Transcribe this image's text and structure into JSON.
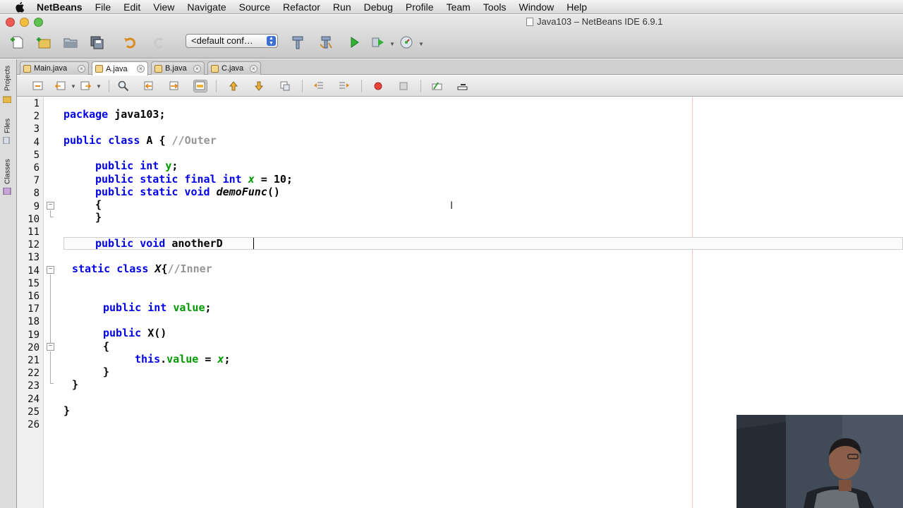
{
  "menubar": {
    "app_name": "NetBeans",
    "items": [
      "File",
      "Edit",
      "View",
      "Navigate",
      "Source",
      "Refactor",
      "Run",
      "Debug",
      "Profile",
      "Team",
      "Tools",
      "Window",
      "Help"
    ]
  },
  "window": {
    "title": "Java103 – NetBeans IDE 6.9.1"
  },
  "toolbar": {
    "config_value": "<default conf…"
  },
  "side_tabs": [
    "Projects",
    "Files",
    "Classes"
  ],
  "editor_tabs": [
    {
      "label": "Main.java",
      "active": false
    },
    {
      "label": "A.java",
      "active": true
    },
    {
      "label": "B.java",
      "active": false
    },
    {
      "label": "C.java",
      "active": false
    }
  ],
  "code_lines": [
    "1",
    "2",
    "3",
    "4",
    "5",
    "6",
    "7",
    "8",
    "9",
    "10",
    "11",
    "12",
    "13",
    "14",
    "15",
    "16",
    "17",
    "18",
    "19",
    "20",
    "21",
    "22",
    "23",
    "24",
    "25",
    "26"
  ],
  "code": {
    "l2_kw": "package",
    "l2_rest": " java103;",
    "l4_kw": "public class",
    "l4_name": " A { ",
    "l4_cm": "//Outer",
    "l6_kw": "public int",
    "l6_fld": "y",
    "l6_end": ";",
    "l7_kw": "public static final int",
    "l7_fld": "x",
    "l7_end": " = 10;",
    "l8_kw": "public static void",
    "l8_fn": "demoFunc",
    "l8_end": "()",
    "l9": "{",
    "l10": "}",
    "l12_kw": "public void",
    "l12_rest": " anotherD",
    "l14_kw": "static class",
    "l14_name": "X",
    "l14_brace": "{",
    "l14_cm": "//Inner",
    "l17_kw": "public int",
    "l17_fld": "value",
    "l17_end": ";",
    "l19_kw": "public",
    "l19_rest": " X()",
    "l20": "{",
    "l21_kw": "this",
    "l21_dot": ".",
    "l21_fld": "value",
    "l21_eq": " = ",
    "l21_x": "x",
    "l21_end": ";",
    "l22": "}",
    "l23": "}",
    "l25": "}"
  },
  "colors": {
    "keyword": "#0000e6",
    "comment": "#969696",
    "field": "#009900"
  }
}
